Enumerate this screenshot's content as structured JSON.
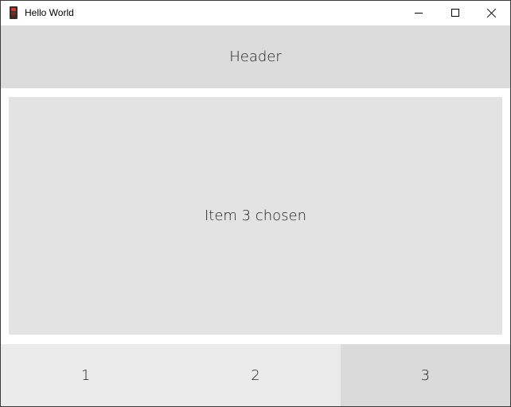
{
  "window": {
    "title": "Hello World",
    "app_icon": "traffic-light-icon",
    "controls": {
      "minimize_icon": "minimize-icon",
      "maximize_icon": "maximize-icon",
      "close_icon": "close-icon"
    }
  },
  "header": {
    "title": "Header",
    "background": "#dcdcdc"
  },
  "content": {
    "text": "Item 3 chosen",
    "background": "#e3e3e3"
  },
  "nav": {
    "items": [
      {
        "label": "1",
        "selected": false
      },
      {
        "label": "2",
        "selected": false
      },
      {
        "label": "3",
        "selected": true
      }
    ],
    "background": "#ebebeb",
    "selected_background": "#dadada"
  }
}
